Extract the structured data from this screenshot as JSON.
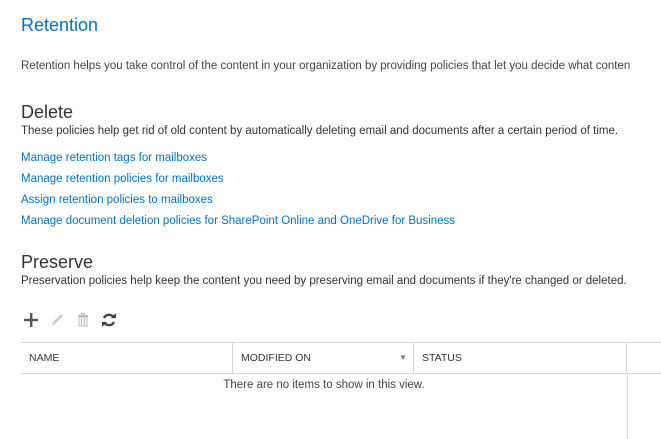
{
  "title": "Retention",
  "intro": "Retention helps you take control of the content in your organization by providing policies that let you decide what conten",
  "delete": {
    "heading": "Delete",
    "description": "These policies help get rid of old content by automatically deleting email and documents after a certain period of time.",
    "links": [
      "Manage retention tags for mailboxes",
      "Manage retention policies for mailboxes",
      "Assign retention policies to mailboxes",
      "Manage document deletion policies for SharePoint Online and OneDrive for Business"
    ]
  },
  "preserve": {
    "heading": "Preserve",
    "description": "Preservation policies help keep the content you need by preserving email and documents if they're changed or deleted.",
    "toolbar": [
      "add-icon",
      "edit-icon",
      "delete-icon",
      "refresh-icon"
    ],
    "columns": [
      "NAME",
      "MODIFIED ON",
      "STATUS"
    ],
    "empty_message": "There are no items to show in this view."
  }
}
